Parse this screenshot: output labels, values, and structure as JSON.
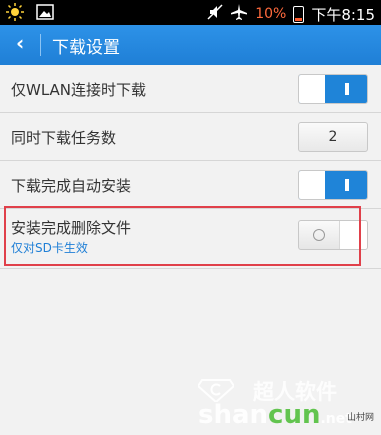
{
  "status_bar": {
    "battery_percent": "10%",
    "time": "下午8:15",
    "icons": [
      "sun-icon",
      "image-icon",
      "no-sound-icon",
      "airplane-icon",
      "battery-icon"
    ]
  },
  "app_bar": {
    "back_glyph": "‹",
    "title": "下载设置"
  },
  "settings": [
    {
      "label": "仅WLAN连接时下载",
      "control": "toggle",
      "state": "on"
    },
    {
      "label": "同时下载任务数",
      "control": "button",
      "value": "2"
    },
    {
      "label": "下载完成自动安装",
      "control": "toggle",
      "state": "on"
    },
    {
      "label": "安装完成删除文件",
      "sublabel": "仅对SD卡生效",
      "control": "toggle",
      "state": "off"
    }
  ],
  "watermark": {
    "top": "超人软件",
    "bottom_prefix": "shan",
    "bottom_mid": "cun",
    "bottom_suffix": ".net",
    "small": "山村网"
  },
  "colors": {
    "accent": "#1f84d8",
    "highlight_border": "#e0404a",
    "battery_text": "#ff6a3d"
  }
}
